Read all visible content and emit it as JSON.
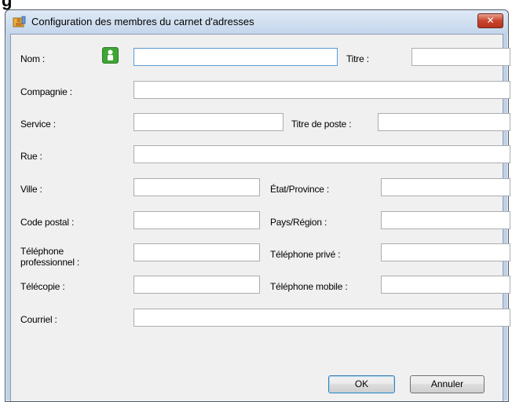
{
  "background_text": "g",
  "dialog": {
    "title": "Configuration des membres du carnet d'adresses",
    "close_symbol": "✕"
  },
  "form": {
    "nom_label": "Nom :",
    "titre_label": "Titre :",
    "compagnie_label": "Compagnie :",
    "service_label": "Service :",
    "titre_poste_label": "Titre de poste :",
    "rue_label": "Rue :",
    "ville_label": "Ville :",
    "etat_label": "État/Province :",
    "code_postal_label": "Code postal :",
    "pays_label": "Pays/Région :",
    "tel_pro_label": "Téléphone professionnel :",
    "tel_prive_label": "Téléphone privé :",
    "telecopie_label": "Télécopie :",
    "tel_mobile_label": "Téléphone mobile :",
    "courriel_label": "Courriel :",
    "values": {
      "nom": "",
      "titre": "",
      "compagnie": "",
      "service": "",
      "titre_poste": "",
      "rue": "",
      "ville": "",
      "etat": "",
      "code_postal": "",
      "pays": "",
      "tel_pro": "",
      "tel_prive": "",
      "telecopie": "",
      "tel_mobile": "",
      "courriel": ""
    }
  },
  "buttons": {
    "ok": "OK",
    "cancel": "Annuler"
  },
  "icons": {
    "title": "address-book-icon",
    "nom": "person-icon",
    "close": "close-icon"
  },
  "colors": {
    "close_button": "#c8452c",
    "person_icon": "#3fa535",
    "focus_border": "#5b9bd5"
  }
}
